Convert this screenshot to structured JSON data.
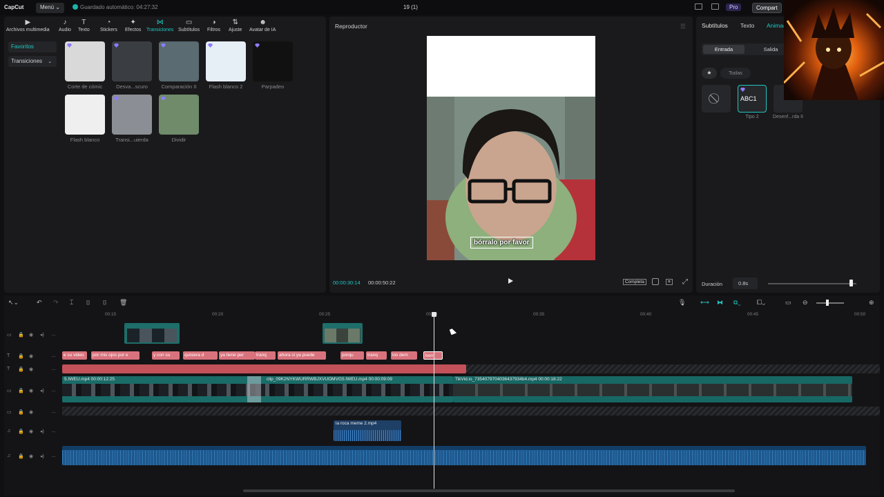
{
  "topbar": {
    "logo": "CapCut",
    "menu": "Menú ⌄",
    "autosave": "Guardado automático: 04:27:32",
    "project_title": "19 (1)",
    "pro": "Pro",
    "share": "Compart"
  },
  "media_tools": [
    {
      "label": "Archivos multimedia",
      "icon": "media-icon"
    },
    {
      "label": "Audio",
      "icon": "audio-icon"
    },
    {
      "label": "Texto",
      "icon": "text-icon"
    },
    {
      "label": "Stickers",
      "icon": "sticker-icon"
    },
    {
      "label": "Efectos",
      "icon": "effects-icon"
    },
    {
      "label": "Transiciones",
      "icon": "transitions-icon",
      "active": true
    },
    {
      "label": "Subtítulos",
      "icon": "subtitles-icon"
    },
    {
      "label": "Filtros",
      "icon": "filters-icon"
    },
    {
      "label": "Ajuste",
      "icon": "adjust-icon"
    },
    {
      "label": "Avatar de IA",
      "icon": "ai-avatar-icon"
    }
  ],
  "sidebar": {
    "favorites": "Favoritos",
    "transitions": "Transiciones"
  },
  "transitions": [
    {
      "label": "Corte de cómic",
      "bg": "#d9d9d9"
    },
    {
      "label": "Desva...scuro",
      "bg": "#3a3d42"
    },
    {
      "label": "Comparación II",
      "bg": "#5a6b72"
    },
    {
      "label": "Flash blanco 2",
      "bg": "#e6eef6"
    },
    {
      "label": "Parpadeo",
      "bg": "#111"
    },
    {
      "label": "Flash blanco",
      "bg": "#efefef"
    },
    {
      "label": "Transi...uierda",
      "bg": "#8b8f95"
    },
    {
      "label": "Dividir",
      "bg": "#6f8b6a"
    }
  ],
  "player": {
    "title": "Reproductor",
    "caption": "bórralo por favor",
    "current_time": "00:00:30:14",
    "total_time": "00:00:50:22",
    "complete_label": "Completa",
    "ratio_label": "≡"
  },
  "props": {
    "tabs": [
      "Subtítulos",
      "Texto",
      "Animac"
    ],
    "entrada": "Entrada",
    "salida": "Salida",
    "todas": "Todas",
    "anim_items": [
      "Tipo 2",
      "Desenf...rda II"
    ],
    "abc": "ABC1",
    "duration_label": "Duración",
    "duration_value": "0.8s",
    "duration_level": 0.95
  },
  "ruler": [
    "00:15",
    "00:20",
    "00:25",
    "00:30",
    "00:35",
    "00:40",
    "00:45",
    "00:50"
  ],
  "text_clips": [
    "e su video",
    "por mis ojos por e",
    "y con su",
    "quisiera d",
    "ya tiene per",
    "tranq",
    "ahora si ya puede",
    "porqu",
    "tranq",
    "los dem",
    "borr"
  ],
  "video_clips": {
    "a": "5.IWEU.mp4   00:00:12:25",
    "b": "clip_09K2NYKWURRWBJXVUOMVG5.IWEU.mp4   00:00:09:09",
    "c": "TikVid.io_7354079704036437934b4.mp4   00:00:18:22"
  },
  "audio_clip": "la roca meme 2.mp4"
}
